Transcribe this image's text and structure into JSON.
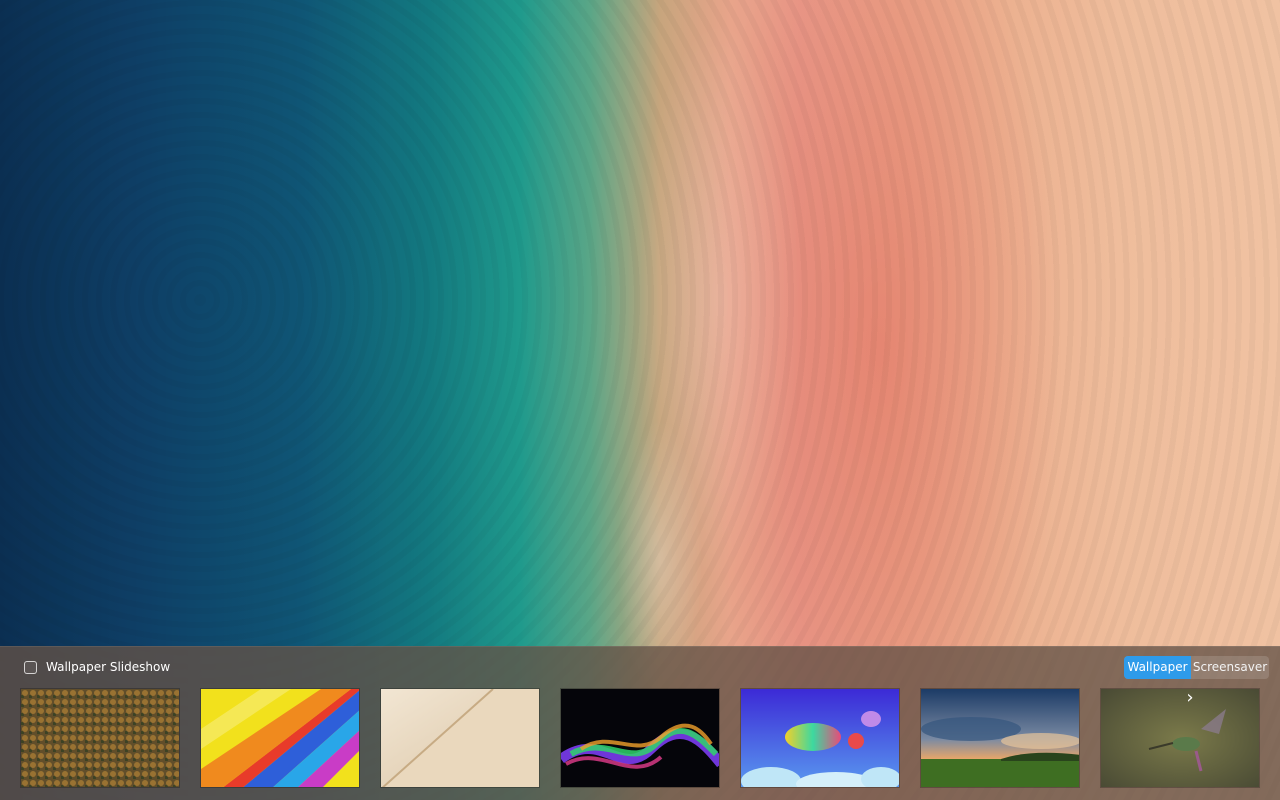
{
  "desktop": {
    "wallpaper_name": "aerial-beach"
  },
  "chooser": {
    "slideshow": {
      "label": "Wallpaper Slideshow",
      "checked": false
    },
    "mode_switch": {
      "wallpaper_label": "Wallpaper",
      "screensaver_label": "Screensaver",
      "active": "Wallpaper",
      "accent_color": "#2e9bea"
    },
    "thumbnails": [
      {
        "name": "autumn-forest",
        "selected": false
      },
      {
        "name": "hot-air-balloon",
        "selected": false
      },
      {
        "name": "sand-dune",
        "selected": false
      },
      {
        "name": "colorful-ribbons",
        "selected": false
      },
      {
        "name": "rainbow-whale",
        "selected": false
      },
      {
        "name": "sunset-meadow",
        "selected": false
      },
      {
        "name": "hummingbird",
        "selected": false
      }
    ],
    "next_icon": "chevron-right-icon",
    "next_glyph": "›"
  }
}
